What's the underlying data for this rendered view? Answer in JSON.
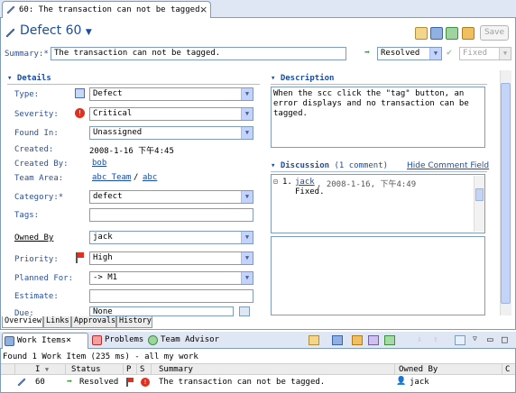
{
  "editor": {
    "tab_title": "60: The transaction can not be tagged.",
    "title": "Defect 60",
    "summary_label": "Summary:*",
    "summary_value": "The transaction can not be tagged.",
    "state_value": "Resolved",
    "resolution_value": "Fixed",
    "save_label": "Save"
  },
  "details": {
    "header": "Details",
    "fields": {
      "type": {
        "label": "Type:",
        "value": "Defect"
      },
      "severity": {
        "label": "Severity:",
        "value": "Critical"
      },
      "found_in": {
        "label": "Found In:",
        "value": "Unassigned"
      },
      "created": {
        "label": "Created:",
        "value": "2008-1-16  下午4:45"
      },
      "created_by": {
        "label": "Created By:",
        "value": "bob"
      },
      "team_area": {
        "label": "Team Area:",
        "value": "abc Team",
        "sep": "/",
        "value2": "abc"
      },
      "category": {
        "label": "Category:*",
        "value": "defect"
      },
      "tags": {
        "label": "Tags:",
        "value": ""
      },
      "owned_by": {
        "label": "Owned By",
        "value": "jack"
      },
      "priority": {
        "label": "Priority:",
        "value": "High"
      },
      "planned_for": {
        "label": "Planned For:",
        "value": "-> M1"
      },
      "estimate": {
        "label": "Estimate:",
        "value": ""
      },
      "due": {
        "label": "Due:",
        "value": "None"
      }
    }
  },
  "description": {
    "header": "Description",
    "text": "When the scc click the \"tag\" button, an error displays and no transaction can be tagged."
  },
  "discussion": {
    "header": "Discussion",
    "count": "(1 comment)",
    "hide_link": "Hide Comment Field",
    "comments": [
      {
        "index": "1.",
        "author": "jack",
        "date": ", 2008-1-16,  下午4:49",
        "text": "Fixed."
      }
    ]
  },
  "editor_tabs": [
    "Overview",
    "Links",
    "Approvals",
    "History"
  ],
  "view": {
    "tabs": [
      "Work Items",
      "Problems",
      "Team Advisor"
    ],
    "status": "Found 1 Work Item (235 ms) - all my work",
    "columns": [
      "I",
      "Status",
      "P",
      "S",
      "Summary",
      "Owned By",
      "C"
    ],
    "rows": [
      {
        "id": "60",
        "status": "Resolved",
        "summary": "The transaction can not be tagged.",
        "owner": "jack"
      }
    ]
  },
  "colors": {
    "accent": "#1d4da0",
    "border": "#7f9db9",
    "severity_critical": "#e03020",
    "state_arrow": "#2f9a2f"
  }
}
